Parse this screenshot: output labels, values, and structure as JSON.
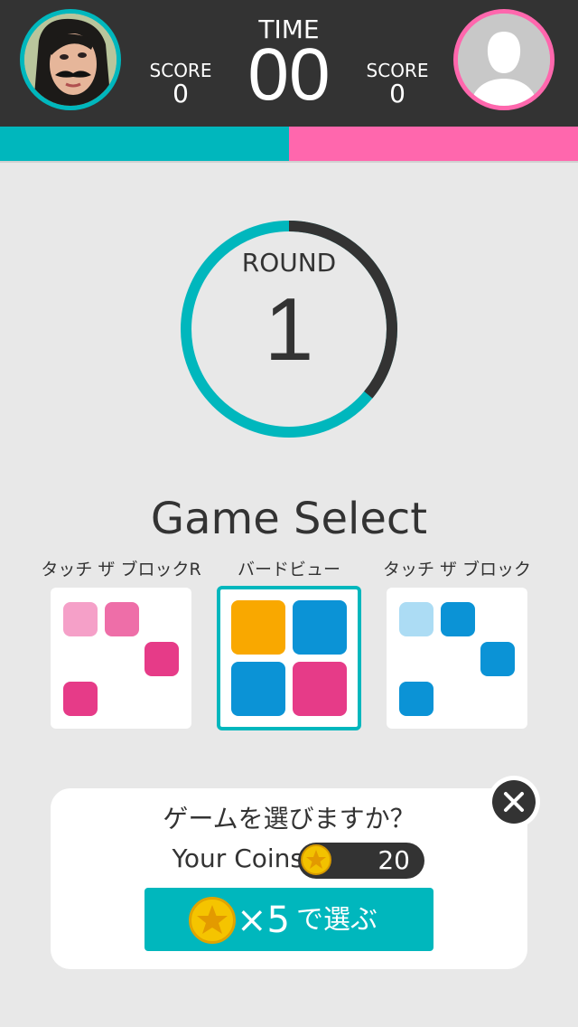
{
  "header": {
    "player1": {
      "score_label": "SCORE",
      "score": "0",
      "avatar": "player-photo"
    },
    "player2": {
      "score_label": "SCORE",
      "score": "0",
      "avatar": "default-person-silhouette"
    },
    "time_label": "TIME",
    "time": "00"
  },
  "round": {
    "label": "ROUND",
    "number": "1",
    "progress_fraction": 0.36
  },
  "game_select": {
    "title": "Game Select",
    "games": [
      {
        "name": "タッチ ザ ブロックR",
        "selected": false
      },
      {
        "name": "バードビュー",
        "selected": true
      },
      {
        "name": "タッチ ザ ブロック",
        "selected": false
      }
    ]
  },
  "dialog": {
    "question": "ゲームを選びますか？",
    "coins_label": "Your Coins",
    "coins_value": "20",
    "button_multiplier": "×5",
    "button_text": "で選ぶ",
    "close_icon": "close-icon"
  },
  "colors": {
    "teal": "#00b7bd",
    "pink": "#ff67ad",
    "dark": "#333333",
    "background": "#e8e8e8",
    "blue": "#0b93d6",
    "orange": "#f9a800",
    "magenta": "#e63b88"
  }
}
